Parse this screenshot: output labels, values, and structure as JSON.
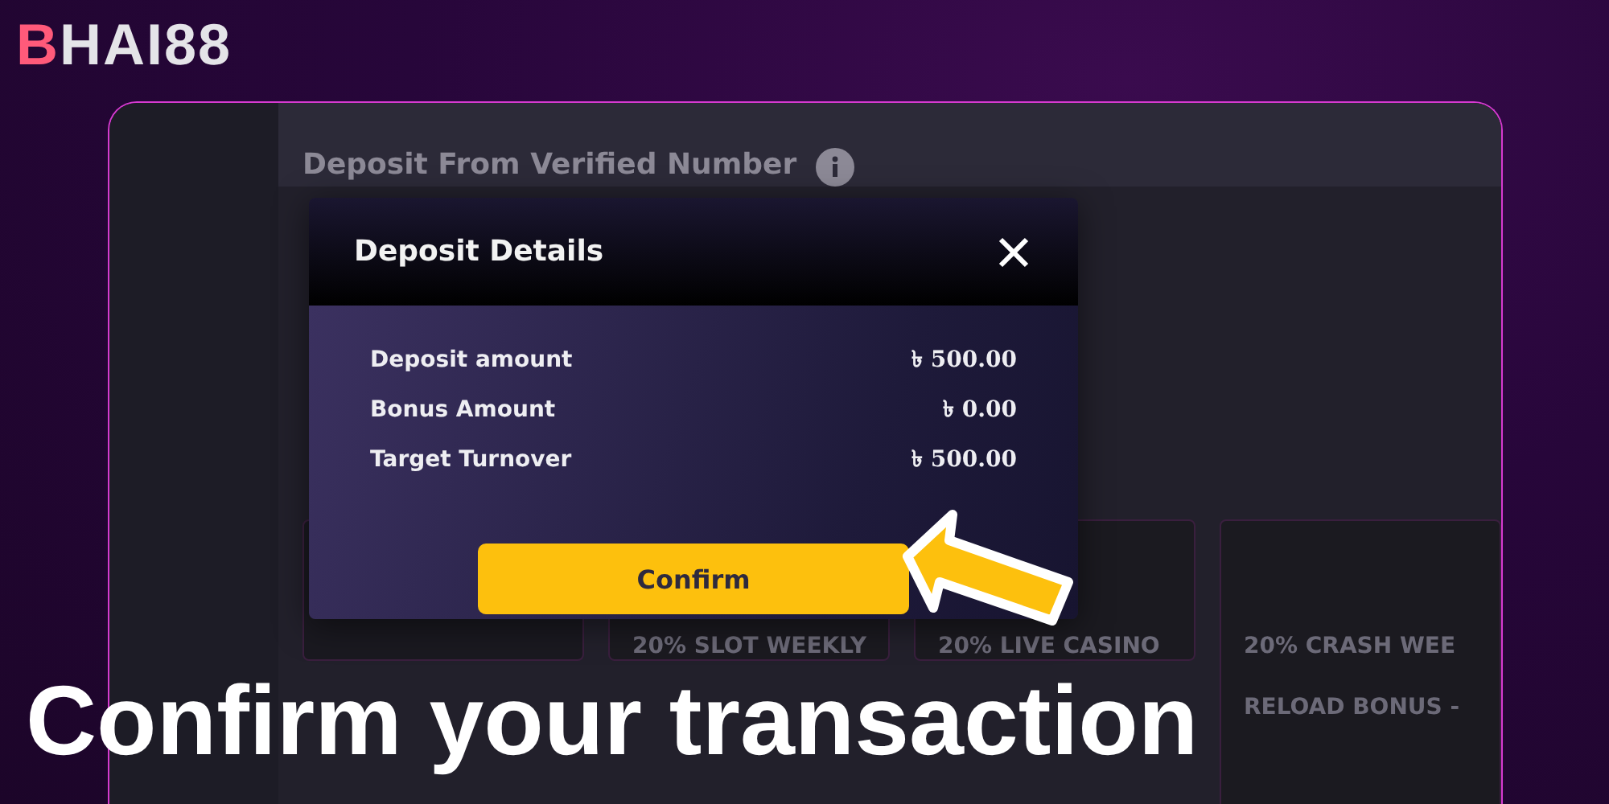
{
  "logo": "BHAI88",
  "page": {
    "heading": "Deposit From Verified Number",
    "cards": [
      {
        "kind": "blank"
      },
      {
        "kind": "bonus",
        "title": "20% SLOT WEEKLY"
      },
      {
        "kind": "bonus",
        "title": "20% LIVE CASINO"
      },
      {
        "kind": "bonus",
        "title": "20% CRASH WEE",
        "subtitle": "RELOAD BONUS -"
      }
    ]
  },
  "dialog": {
    "title": "Deposit Details",
    "rows": [
      {
        "label": "Deposit amount",
        "value": "৳ 500.00"
      },
      {
        "label": "Bonus Amount",
        "value": "৳ 0.00"
      },
      {
        "label": "Target Turnover",
        "value": "৳ 500.00"
      }
    ],
    "button": "Confirm"
  },
  "caption": "Confirm your transaction"
}
